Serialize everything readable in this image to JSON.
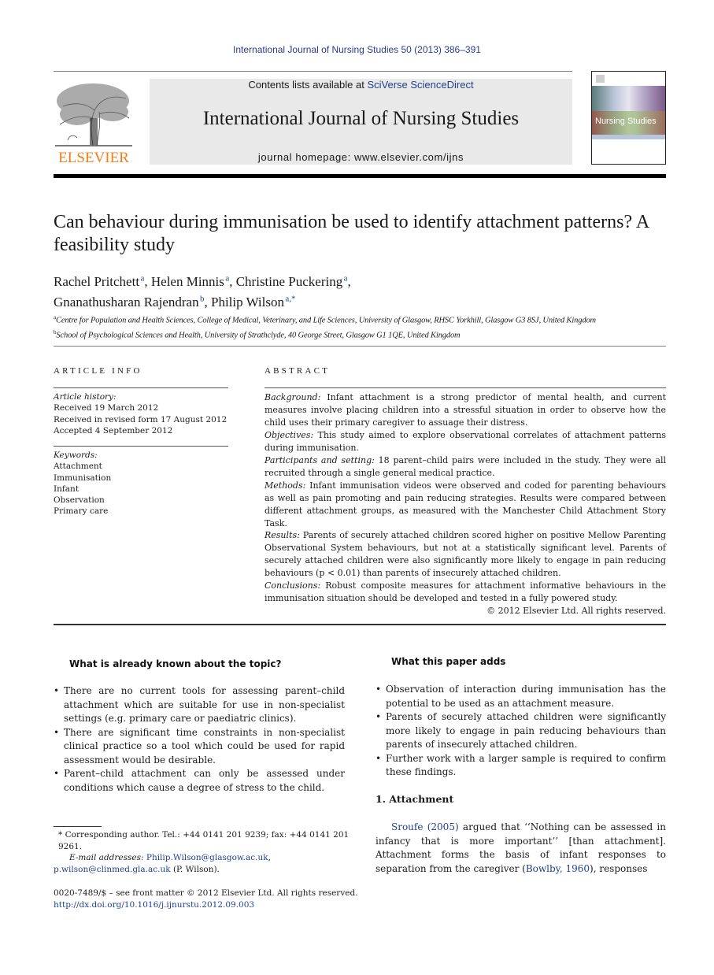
{
  "running_header": "International Journal of Nursing Studies 50 (2013) 386–391",
  "masthead": {
    "publisher_wordmark": "ELSEVIER",
    "contents_prefix": "Contents lists available at ",
    "contents_link": "SciVerse ScienceDirect",
    "journal_title": "International Journal of Nursing Studies",
    "homepage_label": "journal homepage: ",
    "homepage_url": "www.elsevier.com/ijns",
    "cover_title": "Nursing Studies"
  },
  "colors": {
    "link": "#1f3f8f",
    "elsevier_orange": "#f07d1a",
    "masthead_bg": "#e9e9e9"
  },
  "article": {
    "title": "Can behaviour during immunisation be used to identify attachment patterns? A feasibility study",
    "authors": [
      {
        "name": "Rachel Pritchett",
        "aff": "a",
        "sep": ", "
      },
      {
        "name": "Helen Minnis",
        "aff": "a",
        "sep": ", "
      },
      {
        "name": "Christine Puckering",
        "aff": "a",
        "sep": ","
      },
      {
        "name": "Gnanathusharan Rajendran",
        "aff": "b",
        "sep": ", "
      },
      {
        "name": "Philip Wilson",
        "aff": "a,*",
        "sep": ""
      }
    ],
    "affiliations": [
      {
        "mark": "a",
        "text": "Centre for Population and Health Sciences, College of Medical, Veterinary, and Life Sciences, University of Glasgow, RHSC Yorkhill, Glasgow G3 8SJ, United Kingdom"
      },
      {
        "mark": "b",
        "text": "School of Psychological Sciences and Health, University of Strathclyde, 40 George Street, Glasgow G1 1QE, United Kingdom"
      }
    ]
  },
  "article_info": {
    "heading": "ARTICLE INFO",
    "history_label": "Article history:",
    "history": [
      "Received 19 March 2012",
      "Received in revised form 17 August 2012",
      "Accepted 4 September 2012"
    ],
    "keywords_label": "Keywords:",
    "keywords": [
      "Attachment",
      "Immunisation",
      "Infant",
      "Observation",
      "Primary care"
    ]
  },
  "abstract": {
    "heading": "ABSTRACT",
    "sections": [
      {
        "label": "Background:",
        "text": " Infant attachment is a strong predictor of mental health, and current measures involve placing children into a stressful situation in order to observe how the child uses their primary caregiver to assuage their distress."
      },
      {
        "label": "Objectives:",
        "text": " This study aimed to explore observational correlates of attachment patterns during immunisation."
      },
      {
        "label": "Participants and setting:",
        "text": " 18 parent–child pairs were included in the study. They were all recruited through a single general medical practice."
      },
      {
        "label": "Methods:",
        "text": " Infant immunisation videos were observed and coded for parenting behaviours as well as pain promoting and pain reducing strategies. Results were compared between different attachment groups, as measured with the Manchester Child Attachment Story Task."
      },
      {
        "label": "Results:",
        "text": " Parents of securely attached children scored higher on positive Mellow Parenting Observational System behaviours, but not at a statistically significant level. Parents of securely attached children were also significantly more likely to engage in pain reducing behaviours (p < 0.01) than parents of insecurely attached children."
      },
      {
        "label": "Conclusions:",
        "text": " Robust composite measures for attachment informative behaviours in the immunisation situation should be developed and tested in a fully powered study."
      }
    ],
    "copyright": "© 2012 Elsevier Ltd. All rights reserved."
  },
  "known_box": {
    "heading": "What is already known about the topic?",
    "items": [
      "There are no current tools for assessing parent–child attachment which are suitable for use in non-specialist settings (e.g. primary care or paediatric clinics).",
      "There are significant time constraints in non-specialist clinical practice so a tool which could be used for rapid assessment would be desirable.",
      "Parent–child attachment can only be assessed under conditions which cause a degree of stress to the child."
    ]
  },
  "adds_box": {
    "heading": "What this paper adds",
    "items": [
      "Observation of interaction during immunisation has the potential to be used as an attachment measure.",
      "Parents of securely attached children were significantly more likely to engage in pain reducing behaviours than parents of insecurely attached children.",
      "Further work with a larger sample is required to confirm these findings."
    ]
  },
  "section1": {
    "heading": "1. Attachment",
    "cite1": "Sroufe (2005)",
    "text1": " argued that ‘‘Nothing can be assessed in infancy that is more important’’ [than attachment]. Attachment forms the basis of infant responses to separation from the caregiver (",
    "cite2": "Bowlby, 1960",
    "text2": "), responses"
  },
  "footnotes": {
    "corresponding": "* Corresponding author. Tel.: +44 0141 201 9239; fax: +44 0141 201 9261.",
    "email_label": "E-mail addresses: ",
    "email1": "Philip.Wilson@glasgow.ac.uk",
    "email_sep": ",",
    "email2": "p.wilson@clinmed.gla.ac.uk",
    "email_owner": " (P. Wilson).",
    "front_matter": "0020-7489/$ – see front matter © 2012 Elsevier Ltd. All rights reserved.",
    "doi": "http://dx.doi.org/10.1016/j.ijnurstu.2012.09.003"
  }
}
